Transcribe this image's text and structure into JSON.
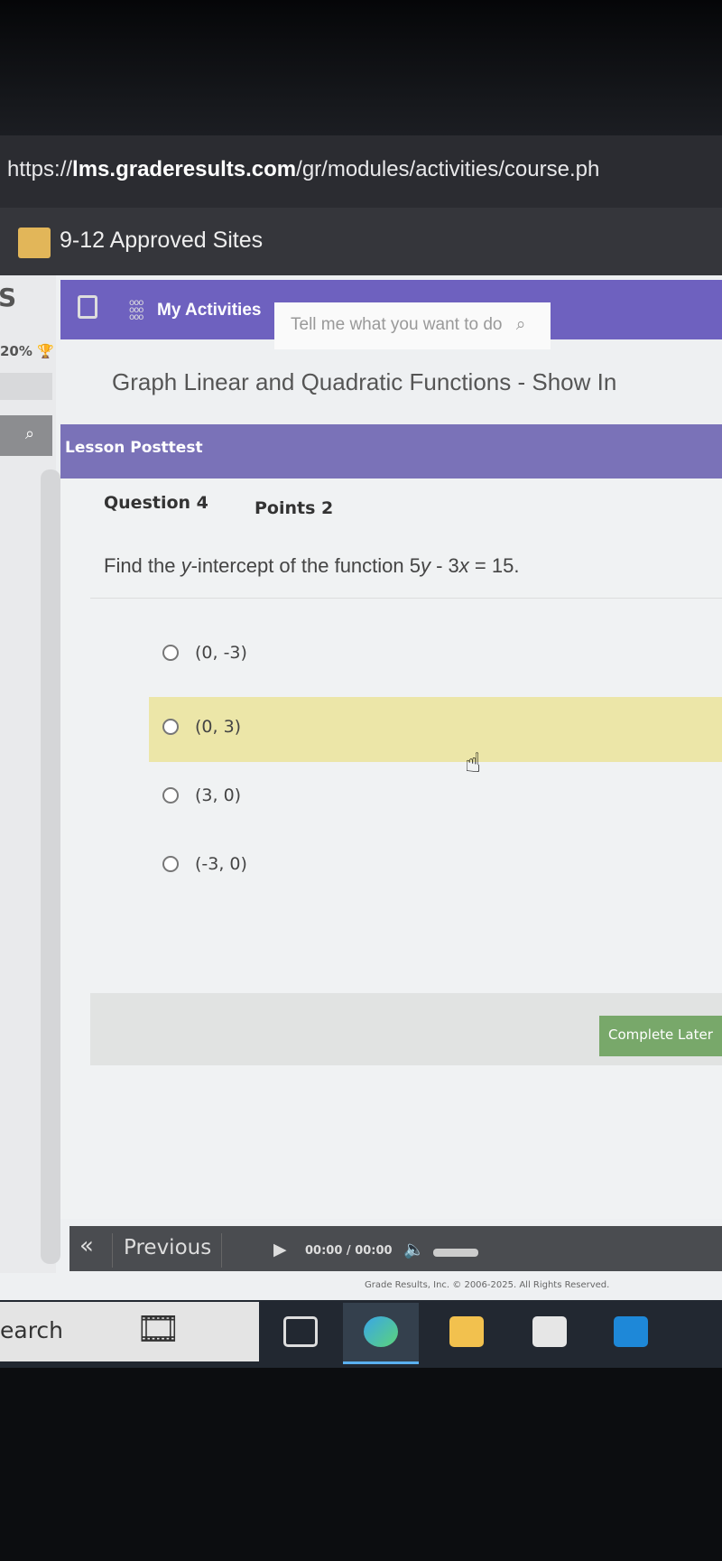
{
  "browser": {
    "url_prefix": "https://",
    "url_domain": "lms.graderesults.com",
    "url_path": "/gr/modules/activities/course.ph"
  },
  "bookmarks": {
    "folder_label": "9-12 Approved Sites"
  },
  "sidebar": {
    "logo_fragment": "S",
    "progress": "20%",
    "search_icon": "search-icon"
  },
  "nav": {
    "my_activities": "My Activities",
    "search_placeholder": "Tell me what you want to do"
  },
  "page": {
    "title": "Graph Linear and Quadratic Functions - Show In",
    "section": "Lesson Posttest"
  },
  "question": {
    "number": "Question 4",
    "points": "Points 2",
    "text_before": "Find the ",
    "var_y": "y",
    "text_mid": "-intercept of the function 5",
    "var_y2": "y",
    "text_minus": " - 3",
    "var_x": "x",
    "text_end": " = 15.",
    "options": [
      {
        "label": "(0, -3)",
        "highlighted": false
      },
      {
        "label": "(0, 3)",
        "highlighted": true
      },
      {
        "label": "(3, 0)",
        "highlighted": false
      },
      {
        "label": "(-3, 0)",
        "highlighted": false
      }
    ]
  },
  "actions": {
    "complete_later": "Complete Later"
  },
  "player": {
    "previous": "Previous",
    "current_time": "00:00",
    "separator": "/",
    "duration": "00:00"
  },
  "footer": {
    "copyright": "Grade Results, Inc. © 2006-2025. All Rights Reserved."
  },
  "taskbar": {
    "search": "earch"
  },
  "colors": {
    "nav": "#6e61bf",
    "highlight": "#ece6a8",
    "complete_button": "#78a86a"
  }
}
